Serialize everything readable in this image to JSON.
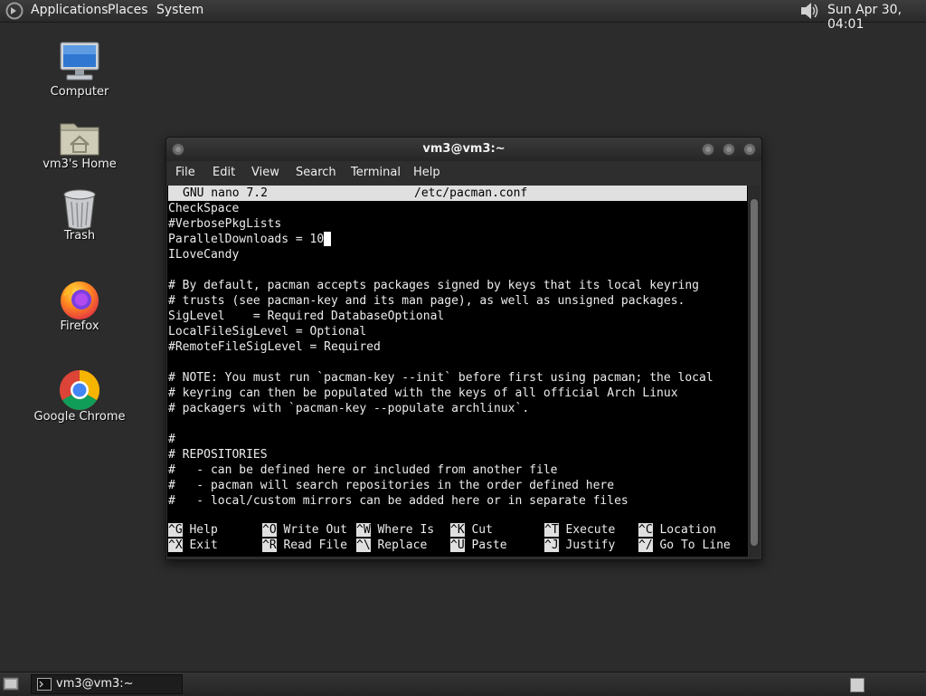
{
  "top_panel": {
    "menus": [
      "Applications",
      "Places",
      "System"
    ],
    "clock": "Sun Apr 30, 04:01"
  },
  "desktop_icons": [
    {
      "label": "Computer",
      "icon": "computer-icon"
    },
    {
      "label": "vm3's Home",
      "icon": "home-folder-icon"
    },
    {
      "label": "Trash",
      "icon": "trash-icon"
    },
    {
      "label": "Firefox",
      "icon": "firefox-icon"
    },
    {
      "label": "Google Chrome",
      "icon": "chrome-icon"
    }
  ],
  "terminal": {
    "title": "vm3@vm3:~",
    "menu": [
      "File",
      "Edit",
      "View",
      "Search",
      "Terminal",
      "Help"
    ],
    "nano_header": {
      "version": "GNU nano 7.2",
      "filename": "/etc/pacman.conf"
    },
    "lines": [
      "CheckSpace",
      "#VerbosePkgLists",
      "ParallelDownloads = 10",
      "ILoveCandy",
      "",
      "# By default, pacman accepts packages signed by keys that its local keyring",
      "# trusts (see pacman-key and its man page), as well as unsigned packages.",
      "SigLevel    = Required DatabaseOptional",
      "LocalFileSigLevel = Optional",
      "#RemoteFileSigLevel = Required",
      "",
      "# NOTE: You must run `pacman-key --init` before first using pacman; the local",
      "# keyring can then be populated with the keys of all official Arch Linux",
      "# packagers with `pacman-key --populate archlinux`.",
      "",
      "#",
      "# REPOSITORIES",
      "#   - can be defined here or included from another file",
      "#   - pacman will search repositories in the order defined here",
      "#   - local/custom mirrors can be added here or in separate files"
    ],
    "shortcuts": [
      {
        "key": "^G",
        "label": "Help"
      },
      {
        "key": "^O",
        "label": "Write Out"
      },
      {
        "key": "^W",
        "label": "Where Is"
      },
      {
        "key": "^K",
        "label": "Cut"
      },
      {
        "key": "^T",
        "label": "Execute"
      },
      {
        "key": "^C",
        "label": "Location"
      },
      {
        "key": "^X",
        "label": "Exit"
      },
      {
        "key": "^R",
        "label": "Read File"
      },
      {
        "key": "^\\",
        "label": "Replace"
      },
      {
        "key": "^U",
        "label": "Paste"
      },
      {
        "key": "^J",
        "label": "Justify"
      },
      {
        "key": "^/",
        "label": "Go To Line"
      }
    ]
  },
  "taskbar": {
    "task_label": "vm3@vm3:~"
  },
  "colors": {
    "desktop_bg": "#2c2c2c",
    "terminal_bg": "#000000",
    "terminal_fg": "#ececec",
    "nano_bar_bg": "#e0e0e0"
  }
}
